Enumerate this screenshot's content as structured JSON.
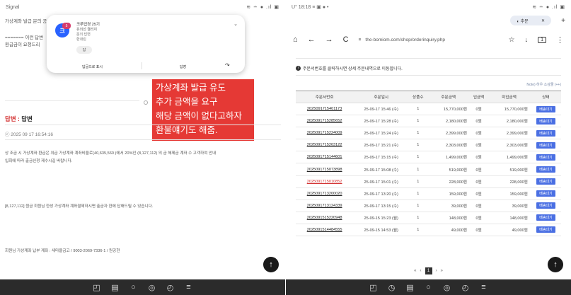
{
  "left": {
    "status_time": "Signal",
    "status_icons": "≋ ∸ ● .ıl ▣",
    "lines": {
      "l1": "가상계좌 발급 문의 공",
      "l2": "======= 이런 답변",
      "l3": "환급금이 요청드리"
    },
    "notification": {
      "logo": "크",
      "badge": "5",
      "title": "크루업경 25기",
      "subtitle": "유의선 결리지",
      "line3": "문의 답변",
      "line4": "환내린",
      "chip": "답",
      "action_left": "답글으로 표시",
      "action_mid": "답장",
      "action_right": "↷"
    },
    "overlay_lines": [
      "가상계좌 발급 유도",
      "추가 금액을 요구",
      "해당 금액이 없다고하자",
      "환불얘기도 해줌."
    ],
    "answer_label": "답변 : ",
    "answer_value": "답변",
    "answer_date": "ⓒ 2025 09 17 16:54:16",
    "body1": "상 조금 시 가상계좌 환급은 위급 가상계좌 계좌비율로(40,635,560 )에서 20%인 (8,127,112) 의 금 해제금 계좌 수 고객하여 안내",
    "body2": "입회에 따라 출금신청 제수시길 바랍니다.",
    "body3": "[8,127,112] 원금 회원님 한성 가상계좌 계좌결제하시면 출금자 한에 답해드릴 수 있습니다.",
    "body4": "회원님 가상계좌 납부 계좌 : 새마을금고 / 9003-2069-7336-1 / 원공현",
    "fab": "↑",
    "nav_icons": [
      "◰",
      "▤",
      "○",
      "◎",
      "◴",
      "≡"
    ]
  },
  "right": {
    "status_time": "U° 18:18 ≡ ▣ ● •",
    "status_icons": "≋ ∸ ● .ıl ▣",
    "tab_label": "◐ 추문",
    "tab_close": "✕",
    "tab_plus": "+",
    "nav": {
      "home": "⌂",
      "back": "←",
      "forward": "→",
      "reload": "C"
    },
    "url_icon": "≡",
    "url": "the-bomiom.com/shop/orderinquiry.php",
    "toolbar_star": "☆",
    "toolbar_mic": "↓",
    "toolbar_tabs": "1",
    "toolbar_menu": "⋮",
    "info_icon": "!",
    "info_text": "주문서번호를 클릭하시면 상세 주문내역으로 이동합니다.",
    "note": "Note) 하우 소감물 (++)",
    "columns": [
      "주문서번호",
      "주문일시",
      "상품수",
      "주문금액",
      "입금액",
      "미입금액",
      "상태"
    ],
    "rows": [
      {
        "no": "2025091715401173",
        "date": "25-09-17 15:46 (수)",
        "qty": "1",
        "amount": "15,770,000원",
        "paid": "0원",
        "unpaid": "15,770,000원",
        "status": "배송대기",
        "hl": false
      },
      {
        "no": "2025091715285652",
        "date": "25-09-17 15:28 (수)",
        "qty": "1",
        "amount": "2,180,000원",
        "paid": "0원",
        "unpaid": "2,180,000원",
        "status": "배송대기",
        "hl": false
      },
      {
        "no": "2025091715224009",
        "date": "25-09-17 15:24 (수)",
        "qty": "1",
        "amount": "2,399,000원",
        "paid": "0원",
        "unpaid": "2,399,000원",
        "status": "배송대기",
        "hl": false
      },
      {
        "no": "2025091715203122",
        "date": "25-09-17 15:21 (수)",
        "qty": "1",
        "amount": "2,303,000원",
        "paid": "0원",
        "unpaid": "2,303,000원",
        "status": "배송대기",
        "hl": false
      },
      {
        "no": "2025091715144601",
        "date": "25-09-17 15:15 (수)",
        "qty": "1",
        "amount": "1,499,000원",
        "paid": "0원",
        "unpaid": "1,499,000원",
        "status": "배송대기",
        "hl": false
      },
      {
        "no": "2025091715073898",
        "date": "25-09-17 15:08 (수)",
        "qty": "1",
        "amount": "519,000원",
        "paid": "0원",
        "unpaid": "519,000원",
        "status": "배송대기",
        "hl": false
      },
      {
        "no": "2025091715010852",
        "date": "25-09-17 15:01 (수)",
        "qty": "1",
        "amount": "228,000원",
        "paid": "0원",
        "unpaid": "228,000원",
        "status": "배송대기",
        "hl": true
      },
      {
        "no": "2025091713200020",
        "date": "25-09-17 13:20 (수)",
        "qty": "1",
        "amount": "159,000원",
        "paid": "0원",
        "unpaid": "159,000원",
        "status": "배송대기",
        "hl": false
      },
      {
        "no": "2025091713124339",
        "date": "25-09-17 13:15 (수)",
        "qty": "1",
        "amount": "39,000원",
        "paid": "0원",
        "unpaid": "39,000원",
        "status": "배송대기",
        "hl": false
      },
      {
        "no": "2025091515220948",
        "date": "25-09-15 15:23 (월)",
        "qty": "1",
        "amount": "148,000원",
        "paid": "0원",
        "unpaid": "148,000원",
        "status": "배송대기",
        "hl": false
      },
      {
        "no": "2025091514484555",
        "date": "25-09-15 14:53 (월)",
        "qty": "1",
        "amount": "49,000원",
        "paid": "0원",
        "unpaid": "49,000원",
        "status": "배송대기",
        "hl": false
      }
    ],
    "pager": {
      "first": "«",
      "prev": "‹",
      "current": "1",
      "next": "›",
      "last": "»"
    },
    "fab": "↑",
    "nav_icons": [
      "◰",
      "◷",
      "▤",
      "○",
      "◎",
      "◴",
      "≡"
    ]
  }
}
